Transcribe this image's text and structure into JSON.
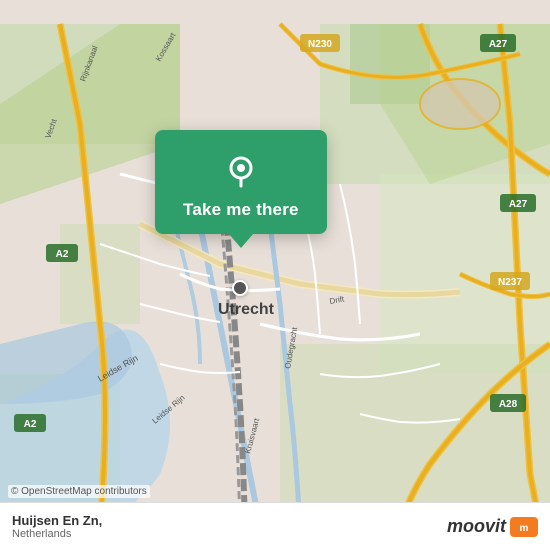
{
  "map": {
    "alt": "Map of Utrecht, Netherlands",
    "copyright": "© OpenStreetMap contributors"
  },
  "popup": {
    "button_label": "Take me there",
    "pin_icon": "location-pin"
  },
  "bottom_bar": {
    "location_name": "Huijsen En Zn,",
    "location_country": "Netherlands",
    "logo_text": "moovit"
  }
}
